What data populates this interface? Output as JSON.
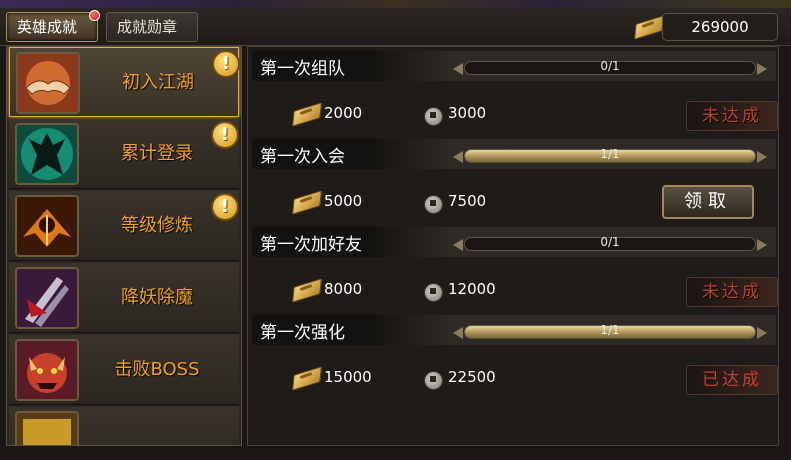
{
  "tabs": [
    {
      "label": "英雄成就",
      "active": true,
      "has_notification": true
    },
    {
      "label": "成就勋章",
      "active": false
    }
  ],
  "currency": {
    "icon": "ticket-icon",
    "amount": "269000"
  },
  "sidebar": {
    "items": [
      {
        "label": "初入江湖",
        "icon": "handshake-icon",
        "active": true,
        "alert": "!"
      },
      {
        "label": "累计登录",
        "icon": "warrior-glow-icon",
        "active": false,
        "alert": "!"
      },
      {
        "label": "等级修炼",
        "icon": "winged-figure-icon",
        "active": false,
        "alert": "!"
      },
      {
        "label": "降妖除魔",
        "icon": "claw-slash-icon",
        "active": false,
        "alert": ""
      },
      {
        "label": "击败BOSS",
        "icon": "demon-face-icon",
        "active": false,
        "alert": ""
      }
    ]
  },
  "achievements": [
    {
      "title": "第一次组队",
      "progress_text": "0/1",
      "progress": 0,
      "reward_ticket": "2000",
      "reward_coin": "3000",
      "status": "未达成",
      "status_kind": "not-reached"
    },
    {
      "title": "第一次入会",
      "progress_text": "1/1",
      "progress": 1,
      "reward_ticket": "5000",
      "reward_coin": "7500",
      "status": "领取",
      "status_kind": "claim"
    },
    {
      "title": "第一次加好友",
      "progress_text": "0/1",
      "progress": 0,
      "reward_ticket": "8000",
      "reward_coin": "12000",
      "status": "未达成",
      "status_kind": "not-reached"
    },
    {
      "title": "第一次强化",
      "progress_text": "1/1",
      "progress": 1,
      "reward_ticket": "15000",
      "reward_coin": "22500",
      "status": "已达成",
      "status_kind": "done"
    }
  ],
  "colors": {
    "accent_gold": "#f0a020",
    "status_red": "#b8432e"
  }
}
